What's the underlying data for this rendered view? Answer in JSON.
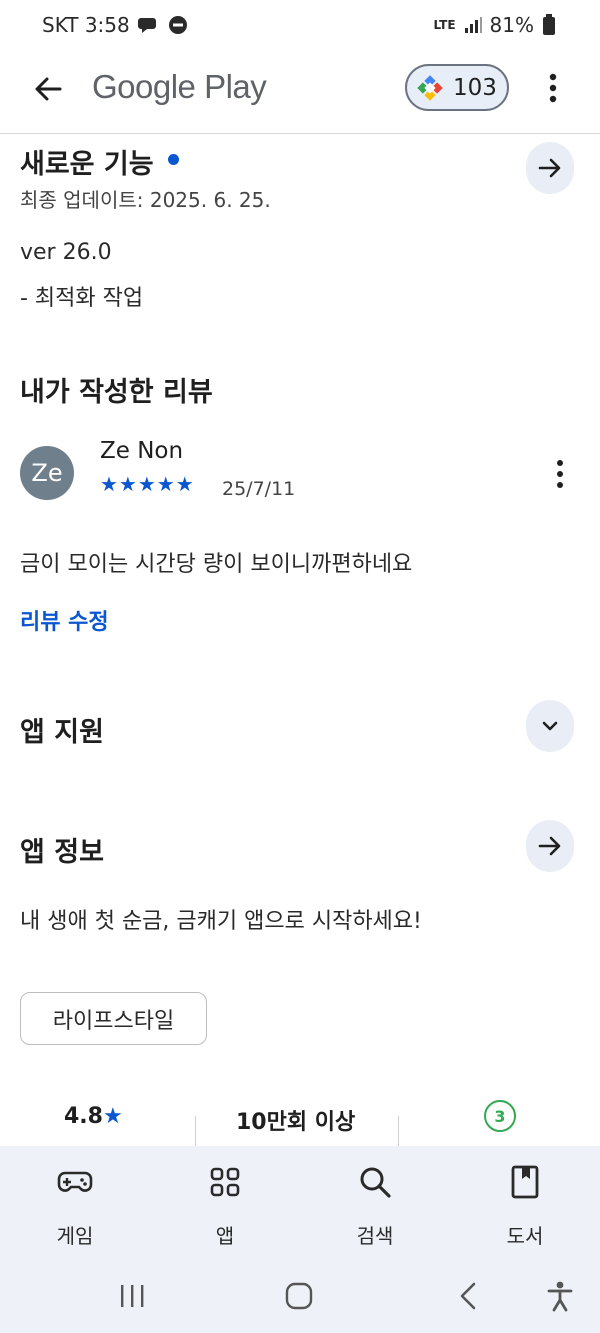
{
  "status_bar": {
    "carrier_time": "SKT 3:58",
    "network": "LTE",
    "battery": "81%"
  },
  "app_bar": {
    "title": "Google Play",
    "points": "103"
  },
  "whats_new": {
    "title": "새로운 기능",
    "last_updated": "최종 업데이트: 2025. 6. 25.",
    "version": "ver 26.0",
    "note": "- 최적화 작업"
  },
  "my_review": {
    "title": "내가 작성한 리뷰",
    "avatar_initials": "Ze",
    "reviewer": "Ze Non",
    "stars": "★★★★★",
    "rating": 5,
    "date": "25/7/11",
    "text": "금이 모이는 시간당 량이 보이니까편하네요",
    "edit_link": "리뷰 수정"
  },
  "app_support": {
    "title": "앱 지원"
  },
  "app_info": {
    "title": "앱 정보",
    "description": "내 생애 첫 순금, 금캐기 앱으로 시작하세요!",
    "category_chip": "라이프스타일"
  },
  "stats": {
    "rating": "4.8",
    "rating_star": "★",
    "downloads": "10만회 이상",
    "age_rating": "3"
  },
  "bottom_nav": {
    "items": [
      {
        "label": "게임",
        "icon": "gamepad-icon"
      },
      {
        "label": "앱",
        "icon": "apps-grid-icon"
      },
      {
        "label": "검색",
        "icon": "search-icon"
      },
      {
        "label": "도서",
        "icon": "book-icon"
      }
    ]
  },
  "colors": {
    "accent": "#0b57d0",
    "nav_background": "#eef2f8",
    "age_rating_green": "#34a853"
  }
}
